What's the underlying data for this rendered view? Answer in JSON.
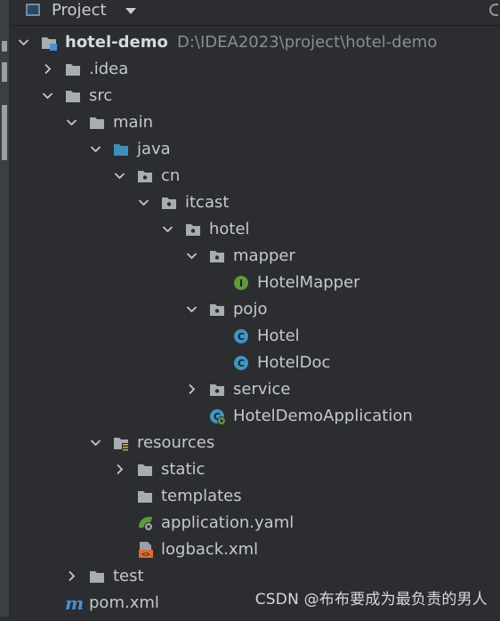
{
  "header": {
    "title": "Project"
  },
  "tree": [
    {
      "label": "hotel-demo",
      "sub": "D:\\IDEA2023\\project\\hotel-demo",
      "icon": "module-folder-icon",
      "depth": 0,
      "expanded": true,
      "bold": true
    },
    {
      "label": ".idea",
      "icon": "folder-icon",
      "depth": 1,
      "expanded": false
    },
    {
      "label": "src",
      "icon": "folder-icon",
      "depth": 1,
      "expanded": true
    },
    {
      "label": "main",
      "icon": "folder-icon",
      "depth": 2,
      "expanded": true
    },
    {
      "label": "java",
      "icon": "source-folder-icon",
      "depth": 3,
      "expanded": true
    },
    {
      "label": "cn",
      "icon": "package-icon",
      "depth": 4,
      "expanded": true
    },
    {
      "label": "itcast",
      "icon": "package-icon",
      "depth": 5,
      "expanded": true
    },
    {
      "label": "hotel",
      "icon": "package-icon",
      "depth": 6,
      "expanded": true
    },
    {
      "label": "mapper",
      "icon": "package-icon",
      "depth": 7,
      "expanded": true
    },
    {
      "label": "HotelMapper",
      "icon": "interface-icon",
      "depth": 8
    },
    {
      "label": "pojo",
      "icon": "package-icon",
      "depth": 7,
      "expanded": true
    },
    {
      "label": "Hotel",
      "icon": "class-icon",
      "depth": 8
    },
    {
      "label": "HotelDoc",
      "icon": "class-icon",
      "depth": 8
    },
    {
      "label": "service",
      "icon": "package-icon",
      "depth": 7,
      "expanded": false
    },
    {
      "label": "HotelDemoApplication",
      "icon": "spring-boot-app-icon",
      "depth": 7
    },
    {
      "label": "resources",
      "icon": "resources-folder-icon",
      "depth": 3,
      "expanded": true
    },
    {
      "label": "static",
      "icon": "folder-icon",
      "depth": 4,
      "expanded": false
    },
    {
      "label": "templates",
      "icon": "folder-icon",
      "depth": 4
    },
    {
      "label": "application.yaml",
      "icon": "yaml-config-icon",
      "depth": 4
    },
    {
      "label": "logback.xml",
      "icon": "xml-file-icon",
      "depth": 4
    },
    {
      "label": "test",
      "icon": "folder-icon",
      "depth": 2,
      "expanded": false
    },
    {
      "label": "pom.xml",
      "icon": "maven-icon",
      "depth": 1
    }
  ],
  "watermark": "CSDN @布布要成为最负责的男人",
  "colors": {
    "background": "#2b2d30",
    "text": "#c5c8cc",
    "folder": "#a7adb3",
    "source_folder": "#3f8fb8",
    "class": "#3f96c2",
    "interface": "#5d9a3b",
    "maven": "#4a8fd6",
    "xml": "#d96c32"
  }
}
